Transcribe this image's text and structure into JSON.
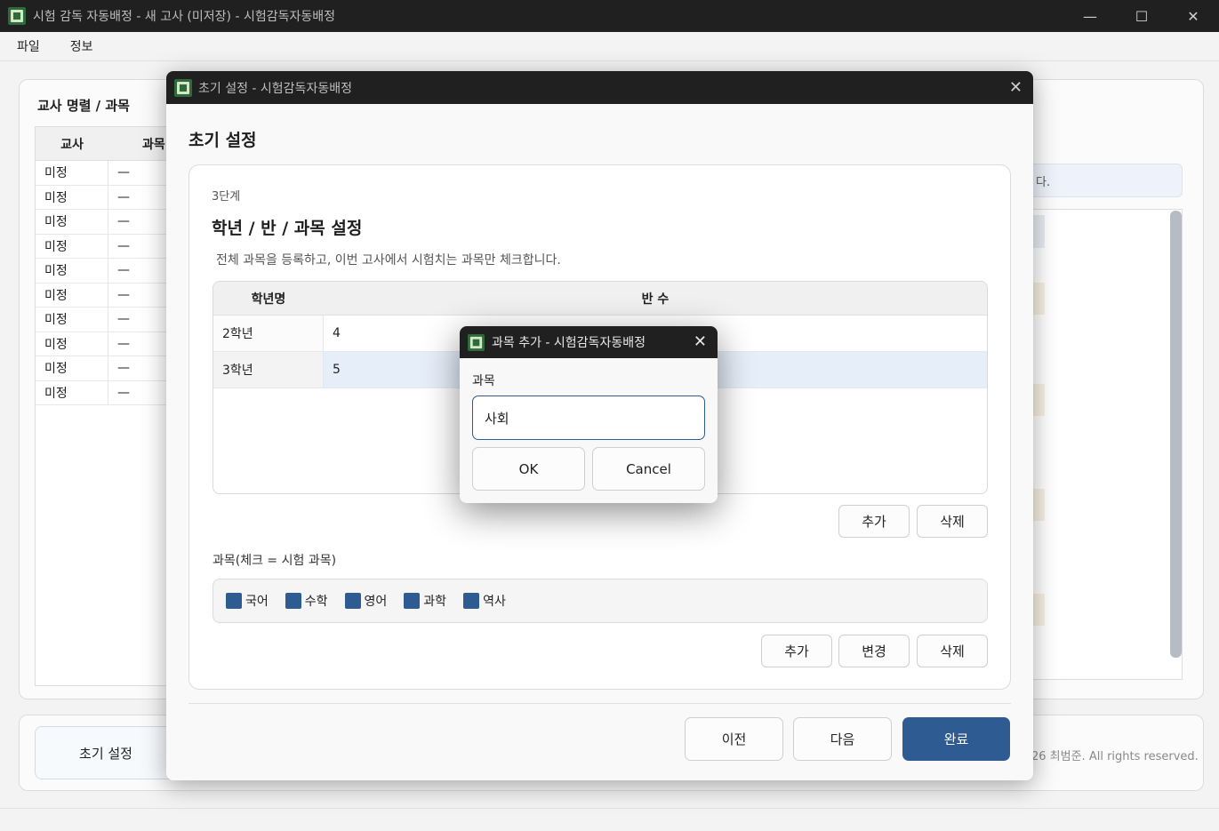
{
  "main_window": {
    "title": "시험 감독 자동배정 - 새 고사 (미저장) - 시험감독자동배정",
    "controls": {
      "minimize": "—",
      "maximize": "☐",
      "close": "✕"
    }
  },
  "menu": {
    "file": "파일",
    "info": "정보"
  },
  "background": {
    "left_panel_title": "교사 명렬 / 과목",
    "table_headers": [
      "교사",
      "과목"
    ],
    "rows": [
      {
        "teacher": "미정",
        "subject": "—"
      },
      {
        "teacher": "미정",
        "subject": "—"
      },
      {
        "teacher": "미정",
        "subject": "—"
      },
      {
        "teacher": "미정",
        "subject": "—"
      },
      {
        "teacher": "미정",
        "subject": "—"
      },
      {
        "teacher": "미정",
        "subject": "—"
      },
      {
        "teacher": "미정",
        "subject": "—"
      },
      {
        "teacher": "미정",
        "subject": "—"
      },
      {
        "teacher": "미정",
        "subject": "—"
      },
      {
        "teacher": "미정",
        "subject": "—"
      }
    ],
    "info_text_fragment": "다.",
    "initial_setup_button": "초기 설정",
    "copyright_fragment": "26 최범준. All rights reserved."
  },
  "wizard": {
    "title": "초기 설정 - 시험감독자동배정",
    "close": "✕",
    "heading": "초기 설정",
    "step": "3단계",
    "section_title": "학년 / 반 / 과목 설정",
    "section_desc": "전체 과목을 등록하고, 이번 고사에서 시험치는 과목만 체크합니다.",
    "grade_table": {
      "headers": [
        "학년명",
        "반 수"
      ],
      "rows": [
        {
          "grade": "2학년",
          "classes": "4"
        },
        {
          "grade": "3학년",
          "classes": "5"
        }
      ]
    },
    "grade_buttons": {
      "add": "추가",
      "delete": "삭제"
    },
    "subject_label": "과목(체크 = 시험 과목)",
    "subjects": [
      {
        "name": "국어",
        "checked": true
      },
      {
        "name": "수학",
        "checked": true
      },
      {
        "name": "영어",
        "checked": true
      },
      {
        "name": "과학",
        "checked": true
      },
      {
        "name": "역사",
        "checked": true
      }
    ],
    "subject_buttons": {
      "add": "추가",
      "change": "변경",
      "delete": "삭제"
    },
    "nav": {
      "prev": "이전",
      "next": "다음",
      "finish": "완료"
    }
  },
  "subject_dialog": {
    "title": "과목 추가 - 시험감독자동배정",
    "close": "✕",
    "label": "과목",
    "value": "사회",
    "ok": "OK",
    "cancel": "Cancel"
  },
  "colors": {
    "accent": "#2f5b93",
    "titlebar": "#202020"
  }
}
